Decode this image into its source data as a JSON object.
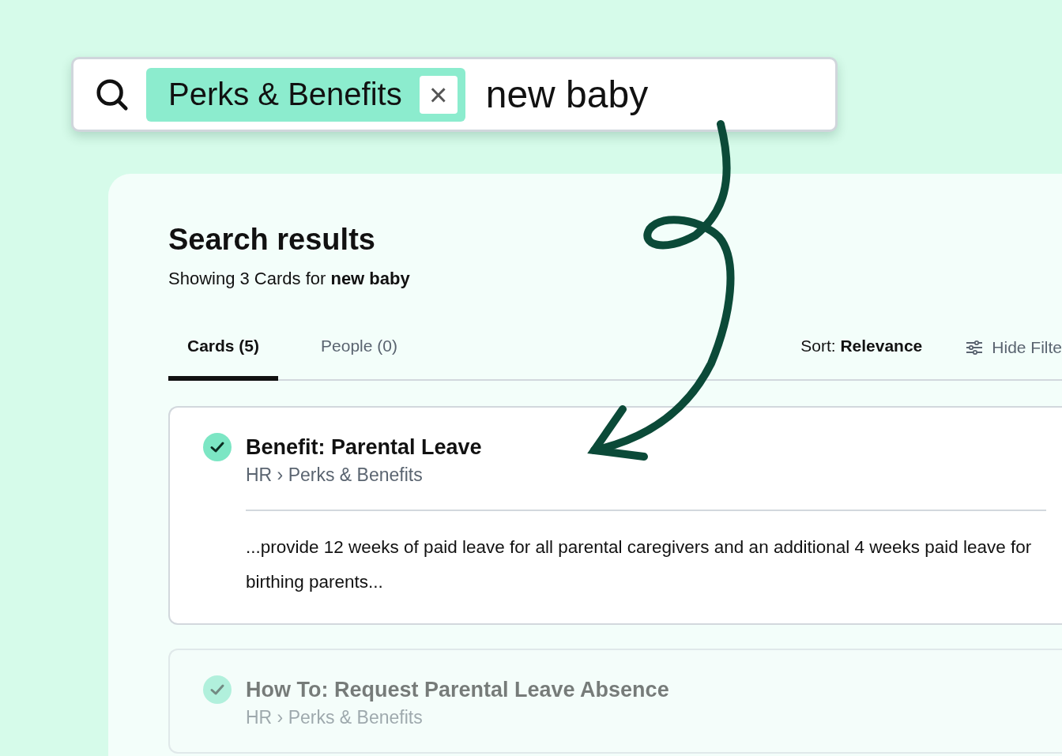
{
  "search": {
    "filter_chip": "Perks & Benefits",
    "chip_close": "×",
    "value": "new baby"
  },
  "results": {
    "title": "Search results",
    "summary": "Showing 3 Cards for **new baby**",
    "tabs": [
      {
        "label": "Cards (5)",
        "selected": true
      },
      {
        "label": "People (0)",
        "selected": false
      }
    ],
    "sort": "Sort: **Relevance**",
    "filter_button": "Hide Filte",
    "cards": [
      {
        "title": "Benefit: Parental Leave",
        "breadcrumb": "HR › Perks & Benefits",
        "excerpt": "...provide 12 weeks of paid leave for all parental caregivers and an additional 4 weeks paid leave for birthing parents...",
        "dimmed": false
      },
      {
        "title": "How To: Request Parental Leave Absence",
        "breadcrumb": "HR › Perks & Benefits",
        "dimmed": true
      }
    ]
  }
}
